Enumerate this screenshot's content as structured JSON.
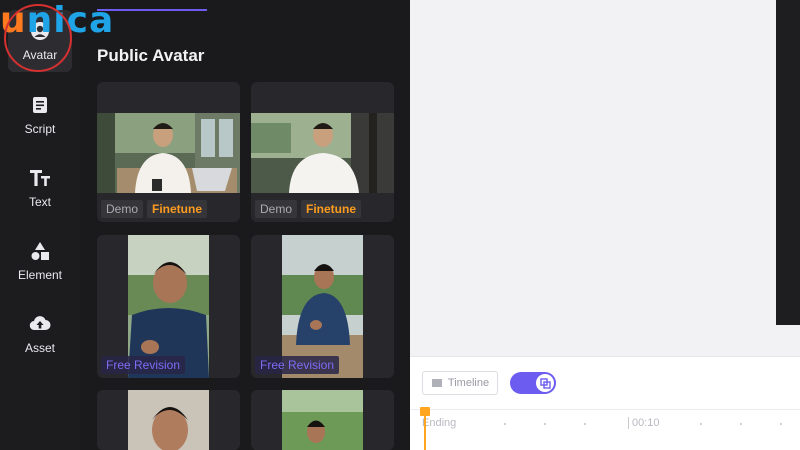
{
  "logo": {
    "first": "u",
    "rest": "nica"
  },
  "rail": {
    "items": [
      {
        "label": "Avatar",
        "icon": "avatar-icon",
        "active": true
      },
      {
        "label": "Script",
        "icon": "script-icon"
      },
      {
        "label": "Text",
        "icon": "text-icon"
      },
      {
        "label": "Element",
        "icon": "element-icon"
      },
      {
        "label": "Asset",
        "icon": "upload-cloud-icon"
      }
    ]
  },
  "panel": {
    "title": "Public Avatar",
    "cards": [
      {
        "tags": [
          "Demo",
          "Finetune"
        ]
      },
      {
        "tags": [
          "Demo",
          "Finetune"
        ]
      },
      {
        "tags": [
          "Free Revision"
        ]
      },
      {
        "tags": [
          "Free Revision"
        ]
      },
      {
        "tags": []
      },
      {
        "tags": []
      }
    ]
  },
  "timeline": {
    "button_label": "Timeline",
    "ending_label": "Ending",
    "time_marker": "00:10"
  },
  "colors": {
    "accent": "#6c5cf0",
    "finetune": "#ff9c1f",
    "logo_orange": "#ff7a1f",
    "logo_blue": "#1fa4e8"
  }
}
